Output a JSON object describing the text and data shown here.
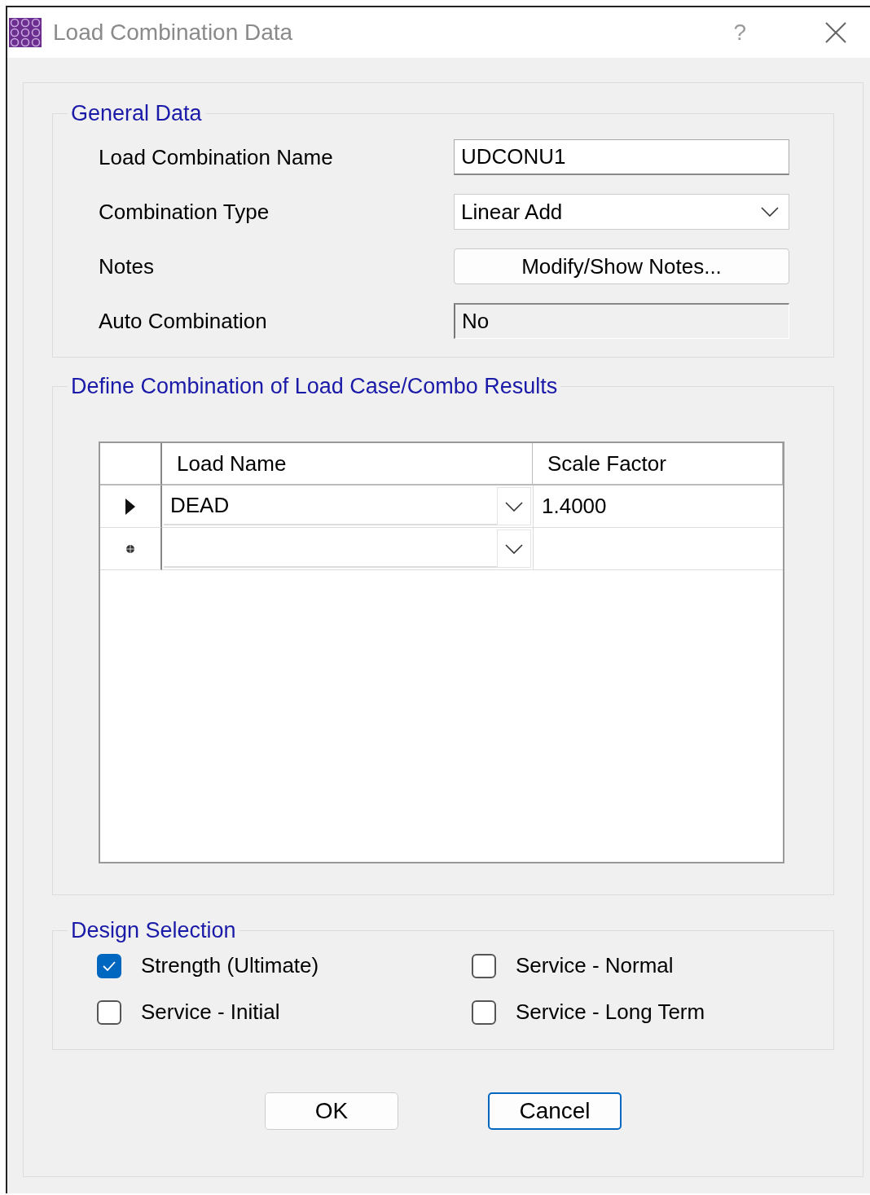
{
  "window": {
    "title": "Load Combination Data",
    "help": "?"
  },
  "general_data": {
    "title": "General Data",
    "fields": [
      {
        "label": "Load Combination Name",
        "kind": "text",
        "value": "UDCONU1"
      },
      {
        "label": "Combination Type",
        "kind": "dropdown",
        "value": "Linear Add"
      },
      {
        "label": "Notes",
        "kind": "button",
        "value": "Modify/Show Notes..."
      },
      {
        "label": "Auto Combination",
        "kind": "readonly",
        "value": "No"
      }
    ]
  },
  "combination": {
    "title": "Define Combination of Load Case/Combo Results",
    "table": {
      "columns": [
        "Load Name",
        "Scale Factor"
      ],
      "rows": [
        {
          "kind": "current",
          "load_name": "DEAD",
          "scale_factor": "1.4000"
        },
        {
          "kind": "new"
        }
      ]
    }
  },
  "design_selection": {
    "title": "Design Selection",
    "options": [
      {
        "label": "Strength (Ultimate)",
        "checked": true
      },
      {
        "label": "Service - Normal",
        "checked": false
      },
      {
        "label": "Service - Initial",
        "checked": false
      },
      {
        "label": "Service - Long Term",
        "checked": false
      }
    ]
  },
  "buttons": [
    {
      "label": "OK",
      "focused": false
    },
    {
      "label": "Cancel",
      "focused": true
    }
  ]
}
